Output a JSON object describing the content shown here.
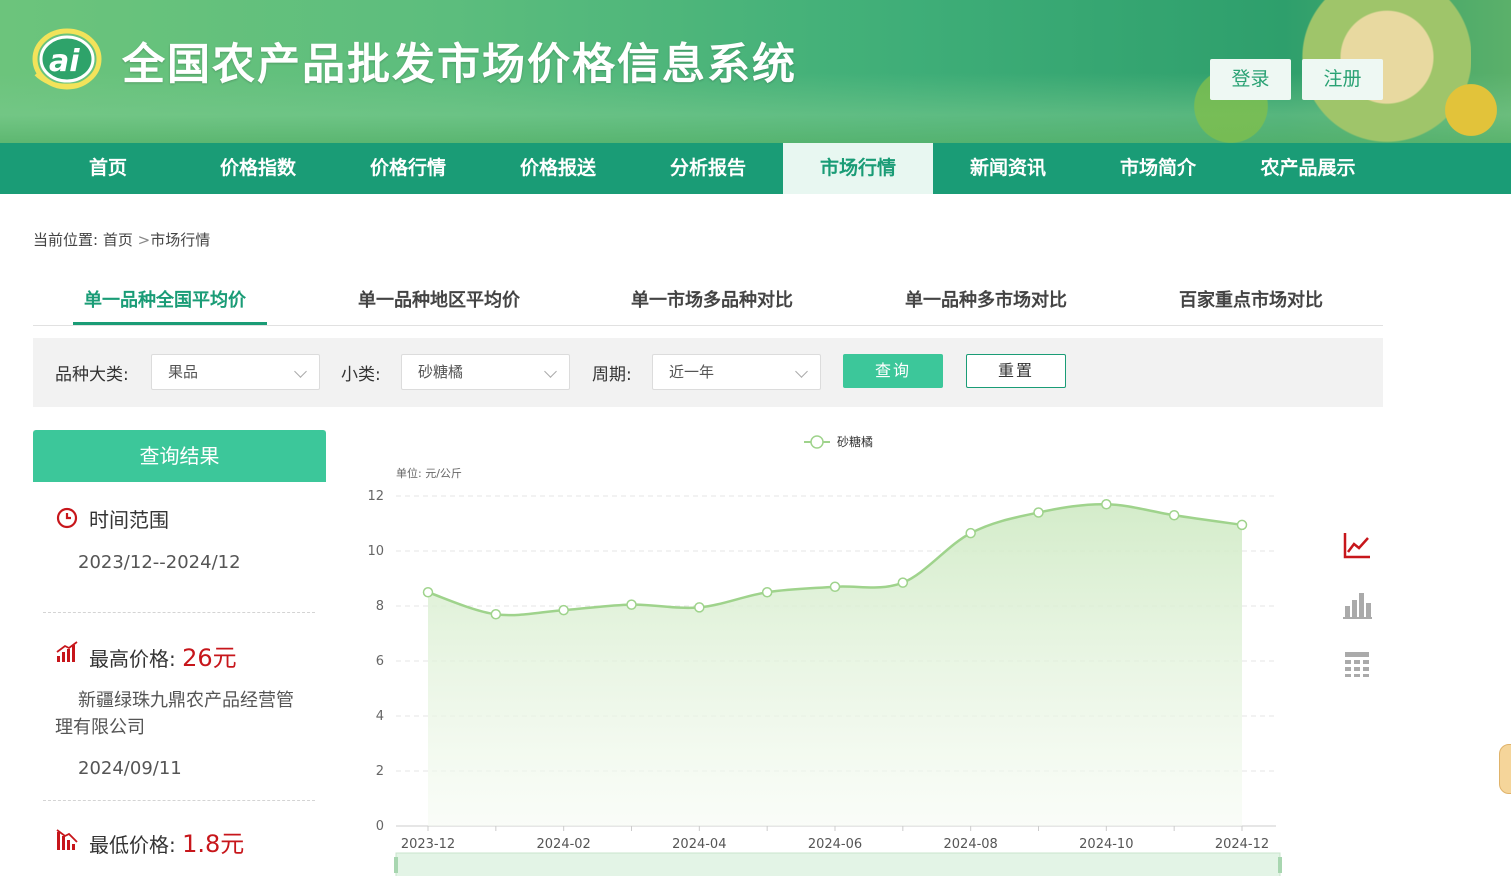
{
  "header": {
    "site_title": "全国农产品批发市场价格信息系统",
    "login_label": "登录",
    "register_label": "注册"
  },
  "nav": {
    "items": [
      {
        "label": "首页"
      },
      {
        "label": "价格指数"
      },
      {
        "label": "价格行情"
      },
      {
        "label": "价格报送"
      },
      {
        "label": "分析报告"
      },
      {
        "label": "市场行情",
        "active": true
      },
      {
        "label": "新闻资讯"
      },
      {
        "label": "市场简介"
      },
      {
        "label": "农产品展示"
      }
    ]
  },
  "breadcrumb": {
    "prefix": "当前位置:",
    "home": "首页",
    "separator": ">",
    "current": "市场行情"
  },
  "tabs": [
    {
      "label": "单一品种全国平均价",
      "active": true
    },
    {
      "label": "单一品种地区平均价"
    },
    {
      "label": "单一市场多品种对比"
    },
    {
      "label": "单一品种多市场对比"
    },
    {
      "label": "百家重点市场对比"
    }
  ],
  "filters": {
    "category_label": "品种大类:",
    "category_value": "果品",
    "subcategory_label": "小类:",
    "subcategory_value": "砂糖橘",
    "period_label": "周期:",
    "period_value": "近一年",
    "query_label": "查询",
    "reset_label": "重置"
  },
  "result_panel": {
    "title": "查询结果",
    "time_range_label": "时间范围",
    "time_range_value": "2023/12--2024/12",
    "max_label": "最高价格:",
    "max_value": "26元",
    "max_market_line1": "新疆绿珠九鼎农产品经营管",
    "max_market_line2": "理有限公司",
    "max_date": "2024/09/11",
    "min_label": "最低价格:",
    "min_value": "1.8元"
  },
  "colors": {
    "brand_green": "#1a9c76",
    "button_green": "#3cc79a",
    "price_red": "#c7161b",
    "series_line": "#9fd38c"
  },
  "chart_data": {
    "type": "area",
    "unit_label": "单位: 元/公斤",
    "legend_position": "top-center",
    "ylim": [
      0,
      12
    ],
    "yticks": [
      0,
      2,
      4,
      6,
      8,
      10,
      12
    ],
    "xtick_labels": [
      "2023-12",
      "2024-02",
      "2024-04",
      "2024-06",
      "2024-08",
      "2024-10",
      "2024-12"
    ],
    "x": [
      "2023-12",
      "2024-01",
      "2024-02",
      "2024-03",
      "2024-04",
      "2024-05",
      "2024-06",
      "2024-07",
      "2024-08",
      "2024-09",
      "2024-10",
      "2024-11",
      "2024-12"
    ],
    "series": [
      {
        "name": "砂糖橘",
        "values": [
          8.5,
          7.7,
          7.85,
          8.05,
          7.95,
          8.5,
          8.7,
          8.85,
          10.65,
          11.4,
          11.7,
          11.3,
          10.95
        ]
      }
    ],
    "grid": true
  },
  "side_icons": [
    "line-chart-icon",
    "bar-chart-icon",
    "table-icon"
  ]
}
